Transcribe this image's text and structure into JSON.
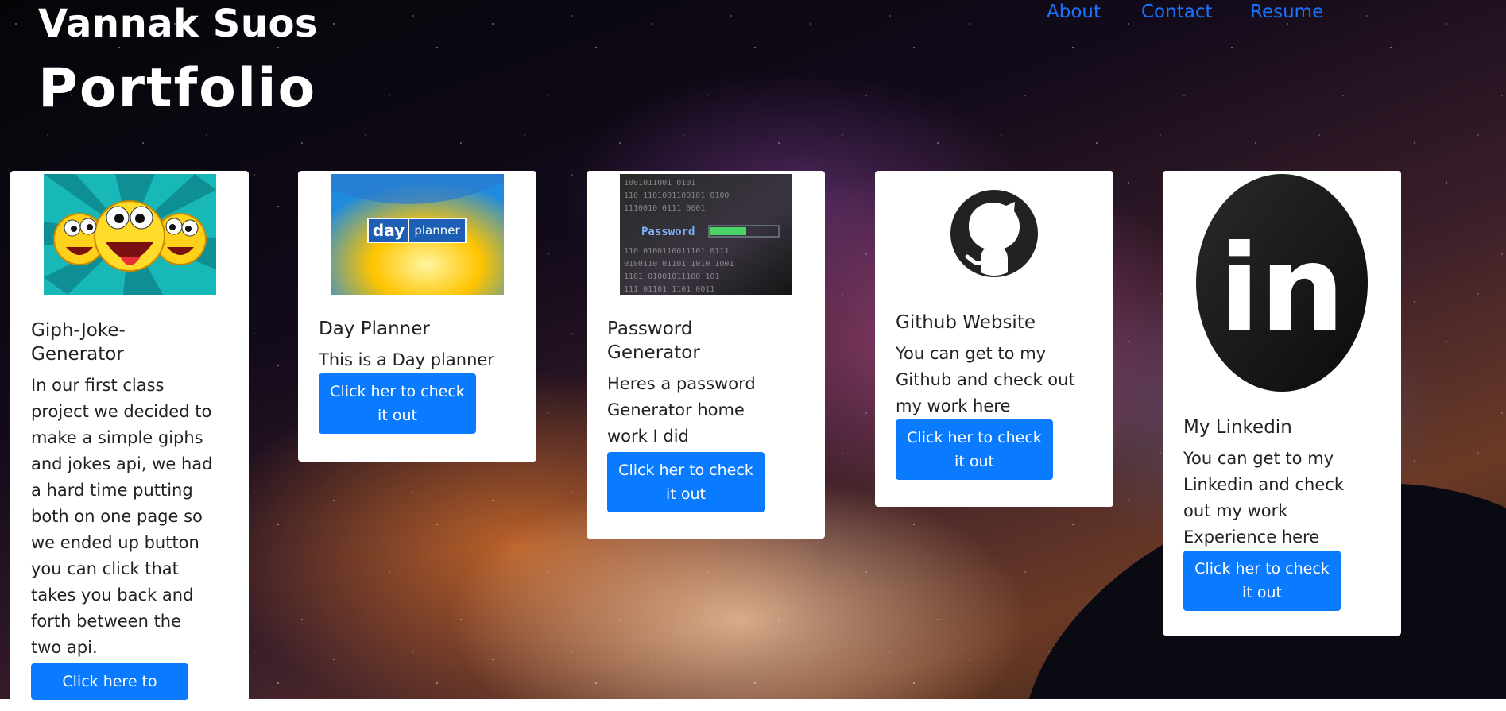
{
  "header": {
    "name": "Vannak Suos",
    "title": "Portfolio"
  },
  "nav": {
    "items": [
      "About",
      "Contact",
      "Resume"
    ]
  },
  "cards": [
    {
      "title": "Giph-Joke-Generator",
      "text": "In our first class project we decided to make a simple giphs and jokes api, we had a hard time putting both on one page so we ended up button you can click that takes you back and forth between the two api.",
      "button": "Click here to",
      "image_icon": "cartoon-faces-icon"
    },
    {
      "title": "Day Planner",
      "text": "This is a Day planner",
      "button": "Click her to check it out",
      "image_icon": "day-planner-logo",
      "image_text": "day planner"
    },
    {
      "title": "Password Generator",
      "text": "Heres a password Generator home work I did",
      "button": "Click her to check it out",
      "image_icon": "password-screen-icon",
      "image_text": "Password"
    },
    {
      "title": "Github Website",
      "text": "You can get to my Github and check out my work here",
      "button": "Click her to check it out",
      "image_icon": "github-icon"
    },
    {
      "title": "My Linkedin",
      "text": "You can get to my Linkedin and check out my work Experience here",
      "button": "Click her to check it out",
      "image_icon": "linkedin-icon",
      "image_text": "in"
    }
  ],
  "colors": {
    "link": "#1a73ff",
    "button": "#0a7bff",
    "card": "#ffffff"
  }
}
